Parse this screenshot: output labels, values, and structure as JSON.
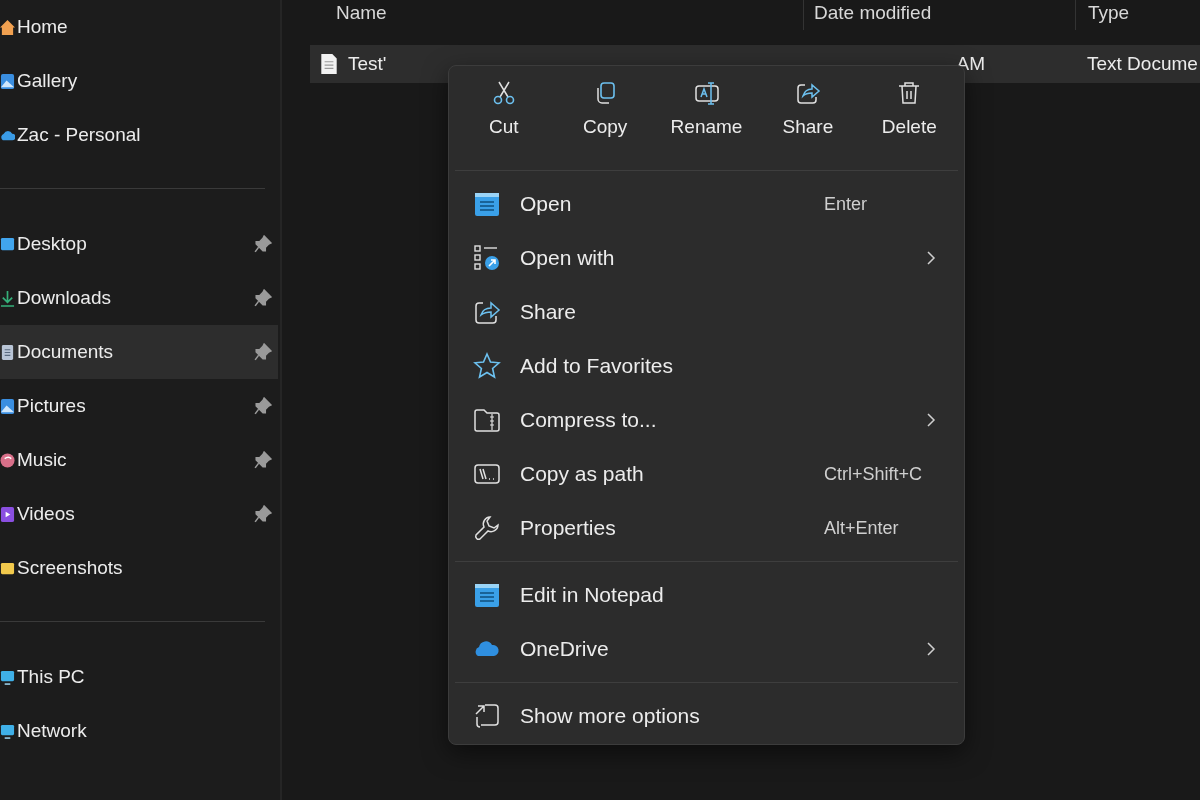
{
  "sidebar": {
    "sections": [
      {
        "items": [
          {
            "label": "Home",
            "kind": "home",
            "pinned": false,
            "selected": false
          },
          {
            "label": "Gallery",
            "kind": "gallery",
            "pinned": false,
            "selected": false
          },
          {
            "label": "Zac - Personal",
            "kind": "cloud",
            "pinned": false,
            "selected": false
          }
        ]
      },
      {
        "items": [
          {
            "label": "Desktop",
            "kind": "desktop",
            "pinned": true,
            "selected": false
          },
          {
            "label": "Downloads",
            "kind": "downloads",
            "pinned": true,
            "selected": false
          },
          {
            "label": "Documents",
            "kind": "documents",
            "pinned": true,
            "selected": true
          },
          {
            "label": "Pictures",
            "kind": "pictures",
            "pinned": true,
            "selected": false
          },
          {
            "label": "Music",
            "kind": "music",
            "pinned": true,
            "selected": false
          },
          {
            "label": "Videos",
            "kind": "videos",
            "pinned": true,
            "selected": false
          },
          {
            "label": "Screenshots",
            "kind": "folder",
            "pinned": false,
            "selected": false
          }
        ]
      },
      {
        "items": [
          {
            "label": "This PC",
            "kind": "pc",
            "pinned": false,
            "selected": false
          },
          {
            "label": "Network",
            "kind": "network",
            "pinned": false,
            "selected": false
          }
        ]
      }
    ]
  },
  "file_list": {
    "columns": [
      "Name",
      "Date modified",
      "Type"
    ],
    "rows": [
      {
        "name": "Test'",
        "date_modified": "AM",
        "type": "Text Docume",
        "selected": true
      }
    ]
  },
  "context_menu": {
    "actions": [
      {
        "label": "Cut",
        "kind": "cut"
      },
      {
        "label": "Copy",
        "kind": "copy"
      },
      {
        "label": "Rename",
        "kind": "rename"
      },
      {
        "label": "Share",
        "kind": "share"
      },
      {
        "label": "Delete",
        "kind": "delete"
      }
    ],
    "groups": [
      {
        "items": [
          {
            "label": "Open",
            "kind": "notepad",
            "shortcut": "Enter",
            "submenu": false
          },
          {
            "label": "Open with",
            "kind": "open-with",
            "submenu": true
          },
          {
            "label": "Share",
            "kind": "share",
            "submenu": false
          },
          {
            "label": "Add to Favorites",
            "kind": "star",
            "submenu": false
          },
          {
            "label": "Compress to...",
            "kind": "compress",
            "submenu": true
          },
          {
            "label": "Copy as path",
            "kind": "copy-path",
            "shortcut": "Ctrl+Shift+C",
            "submenu": false
          },
          {
            "label": "Properties",
            "kind": "wrench",
            "shortcut": "Alt+Enter",
            "submenu": false
          }
        ]
      },
      {
        "items": [
          {
            "label": "Edit in Notepad",
            "kind": "notepad",
            "submenu": false
          },
          {
            "label": "OneDrive",
            "kind": "onedrive",
            "submenu": true
          }
        ]
      },
      {
        "items": [
          {
            "label": "Show more options",
            "kind": "more",
            "submenu": false
          }
        ]
      }
    ]
  }
}
